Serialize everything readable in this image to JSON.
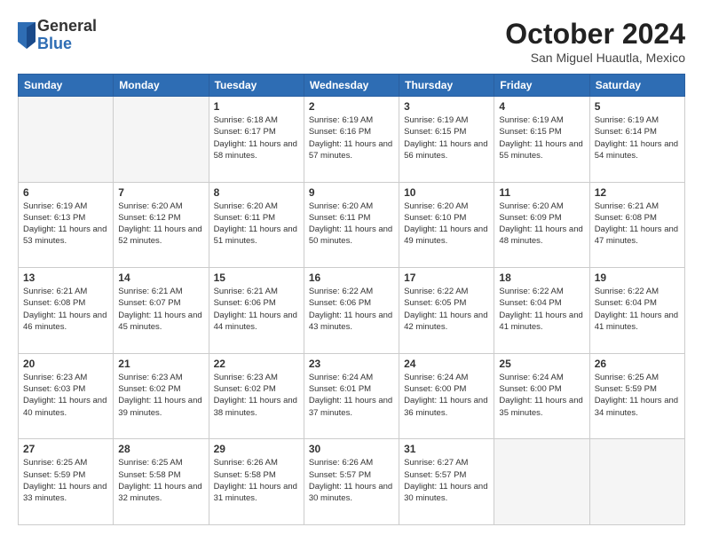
{
  "header": {
    "logo": {
      "general": "General",
      "blue": "Blue"
    },
    "title": "October 2024",
    "location": "San Miguel Huautla, Mexico"
  },
  "calendar": {
    "headers": [
      "Sunday",
      "Monday",
      "Tuesday",
      "Wednesday",
      "Thursday",
      "Friday",
      "Saturday"
    ],
    "weeks": [
      [
        {
          "day": "",
          "empty": true
        },
        {
          "day": "",
          "empty": true
        },
        {
          "day": "1",
          "sunrise": "6:18 AM",
          "sunset": "6:17 PM",
          "daylight": "11 hours and 58 minutes."
        },
        {
          "day": "2",
          "sunrise": "6:19 AM",
          "sunset": "6:16 PM",
          "daylight": "11 hours and 57 minutes."
        },
        {
          "day": "3",
          "sunrise": "6:19 AM",
          "sunset": "6:15 PM",
          "daylight": "11 hours and 56 minutes."
        },
        {
          "day": "4",
          "sunrise": "6:19 AM",
          "sunset": "6:15 PM",
          "daylight": "11 hours and 55 minutes."
        },
        {
          "day": "5",
          "sunrise": "6:19 AM",
          "sunset": "6:14 PM",
          "daylight": "11 hours and 54 minutes."
        }
      ],
      [
        {
          "day": "6",
          "sunrise": "6:19 AM",
          "sunset": "6:13 PM",
          "daylight": "11 hours and 53 minutes."
        },
        {
          "day": "7",
          "sunrise": "6:20 AM",
          "sunset": "6:12 PM",
          "daylight": "11 hours and 52 minutes."
        },
        {
          "day": "8",
          "sunrise": "6:20 AM",
          "sunset": "6:11 PM",
          "daylight": "11 hours and 51 minutes."
        },
        {
          "day": "9",
          "sunrise": "6:20 AM",
          "sunset": "6:11 PM",
          "daylight": "11 hours and 50 minutes."
        },
        {
          "day": "10",
          "sunrise": "6:20 AM",
          "sunset": "6:10 PM",
          "daylight": "11 hours and 49 minutes."
        },
        {
          "day": "11",
          "sunrise": "6:20 AM",
          "sunset": "6:09 PM",
          "daylight": "11 hours and 48 minutes."
        },
        {
          "day": "12",
          "sunrise": "6:21 AM",
          "sunset": "6:08 PM",
          "daylight": "11 hours and 47 minutes."
        }
      ],
      [
        {
          "day": "13",
          "sunrise": "6:21 AM",
          "sunset": "6:08 PM",
          "daylight": "11 hours and 46 minutes."
        },
        {
          "day": "14",
          "sunrise": "6:21 AM",
          "sunset": "6:07 PM",
          "daylight": "11 hours and 45 minutes."
        },
        {
          "day": "15",
          "sunrise": "6:21 AM",
          "sunset": "6:06 PM",
          "daylight": "11 hours and 44 minutes."
        },
        {
          "day": "16",
          "sunrise": "6:22 AM",
          "sunset": "6:06 PM",
          "daylight": "11 hours and 43 minutes."
        },
        {
          "day": "17",
          "sunrise": "6:22 AM",
          "sunset": "6:05 PM",
          "daylight": "11 hours and 42 minutes."
        },
        {
          "day": "18",
          "sunrise": "6:22 AM",
          "sunset": "6:04 PM",
          "daylight": "11 hours and 41 minutes."
        },
        {
          "day": "19",
          "sunrise": "6:22 AM",
          "sunset": "6:04 PM",
          "daylight": "11 hours and 41 minutes."
        }
      ],
      [
        {
          "day": "20",
          "sunrise": "6:23 AM",
          "sunset": "6:03 PM",
          "daylight": "11 hours and 40 minutes."
        },
        {
          "day": "21",
          "sunrise": "6:23 AM",
          "sunset": "6:02 PM",
          "daylight": "11 hours and 39 minutes."
        },
        {
          "day": "22",
          "sunrise": "6:23 AM",
          "sunset": "6:02 PM",
          "daylight": "11 hours and 38 minutes."
        },
        {
          "day": "23",
          "sunrise": "6:24 AM",
          "sunset": "6:01 PM",
          "daylight": "11 hours and 37 minutes."
        },
        {
          "day": "24",
          "sunrise": "6:24 AM",
          "sunset": "6:00 PM",
          "daylight": "11 hours and 36 minutes."
        },
        {
          "day": "25",
          "sunrise": "6:24 AM",
          "sunset": "6:00 PM",
          "daylight": "11 hours and 35 minutes."
        },
        {
          "day": "26",
          "sunrise": "6:25 AM",
          "sunset": "5:59 PM",
          "daylight": "11 hours and 34 minutes."
        }
      ],
      [
        {
          "day": "27",
          "sunrise": "6:25 AM",
          "sunset": "5:59 PM",
          "daylight": "11 hours and 33 minutes."
        },
        {
          "day": "28",
          "sunrise": "6:25 AM",
          "sunset": "5:58 PM",
          "daylight": "11 hours and 32 minutes."
        },
        {
          "day": "29",
          "sunrise": "6:26 AM",
          "sunset": "5:58 PM",
          "daylight": "11 hours and 31 minutes."
        },
        {
          "day": "30",
          "sunrise": "6:26 AM",
          "sunset": "5:57 PM",
          "daylight": "11 hours and 30 minutes."
        },
        {
          "day": "31",
          "sunrise": "6:27 AM",
          "sunset": "5:57 PM",
          "daylight": "11 hours and 30 minutes."
        },
        {
          "day": "",
          "empty": true
        },
        {
          "day": "",
          "empty": true
        }
      ]
    ]
  }
}
